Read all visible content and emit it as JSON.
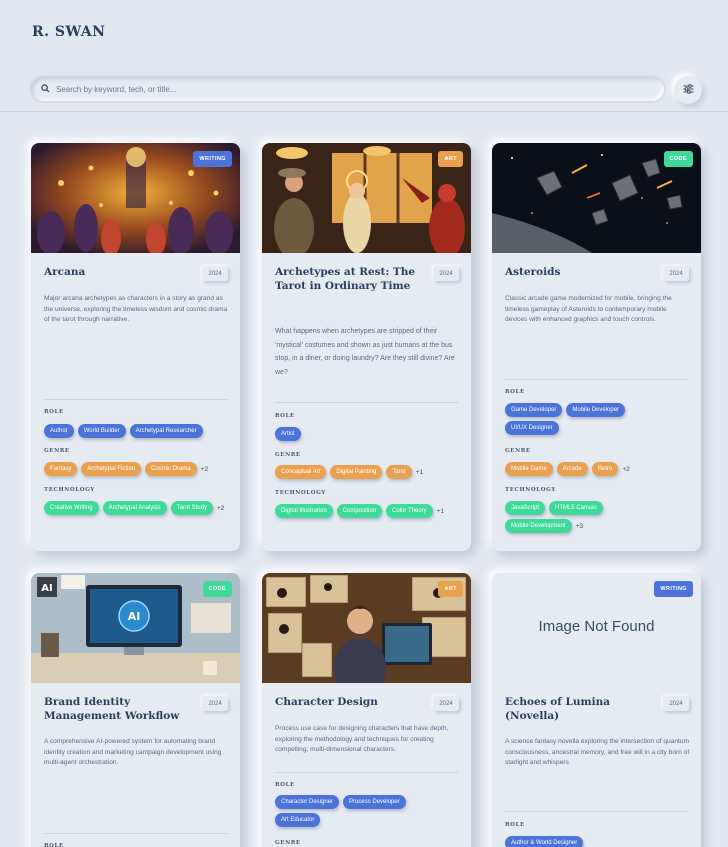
{
  "brand": "R. SWAN",
  "search": {
    "placeholder": "Search by keyword, tech, or title..."
  },
  "colors": {
    "background": "#e3e8f0",
    "writing": "#4b73d8",
    "art": "#e9a04f",
    "code": "#3fd99a",
    "title": "#2b3d5c"
  },
  "labels": {
    "role": "ROLE",
    "genre": "GENRE",
    "technology": "TECHNOLOGY"
  },
  "cards": [
    {
      "title": "Arcana",
      "year": "2024",
      "category": "WRITING",
      "description": "Major arcana archetypes as characters in a story as grand as the universe, exploring the timeless wisdom and cosmic drama of the tarot through narrative.",
      "roles": [
        "Author",
        "World Builder",
        "Archetypal Researcher"
      ],
      "genres": [
        "Fantasy",
        "Archetypal Fiction",
        "Cosmic Drama"
      ],
      "genres_more": "+2",
      "technology": [
        "Creative Writing",
        "Archetypal Analysis",
        "Tarot Study"
      ],
      "technology_more": "+2"
    },
    {
      "title": "Archetypes at Rest: The Tarot in Ordinary Time",
      "year": "2024",
      "category": "ART",
      "description": "What happens when archetypes are stripped of their 'mystical' costumes and shown as just humans at the bus stop, in a diner, or doing laundry? Are they still divine? Are we?",
      "roles": [
        "Artist"
      ],
      "genres": [
        "Conceptual Art",
        "Digital Painting",
        "Tarot"
      ],
      "genres_more": "+1",
      "technology": [
        "Digital Illustration",
        "Composition",
        "Color Theory"
      ],
      "technology_more": "+1"
    },
    {
      "title": "Asteroids",
      "year": "2024",
      "category": "CODE",
      "description": "Classic arcade game modernized for mobile, bringing the timeless gameplay of Asteroids to contemporary mobile devices with enhanced graphics and touch controls.",
      "roles": [
        "Game Developer",
        "Mobile Developer",
        "UI/UX Designer"
      ],
      "genres": [
        "Mobile Game",
        "Arcade",
        "Retro"
      ],
      "genres_more": "+2",
      "technology": [
        "JavaScript",
        "HTML5 Canvas",
        "Mobile Development"
      ],
      "technology_more": "+3"
    },
    {
      "title": "Brand Identity Management Workflow",
      "year": "2024",
      "category": "CODE",
      "description": "A comprehensive AI-powered system for automating brand identity creation and marketing campaign development using multi-agent orchestration."
    },
    {
      "title": "Character Design",
      "year": "2024",
      "category": "ART",
      "description": "Process use case for designing characters that have depth, exploring the methodology and techniques for creating compelling, multi-dimensional characters.",
      "roles": [
        "Character Designer",
        "Process Developer",
        "Art Educator"
      ]
    },
    {
      "title": "Echoes of Lumina (Novella)",
      "year": "2024",
      "category": "WRITING",
      "image_text": "Image Not Found",
      "description": "A science fantasy novella exploring the intersection of quantum consciousness, ancestral memory, and free will in a city born of starlight and whispers",
      "roles": [
        "Author & World Designer"
      ]
    }
  ]
}
